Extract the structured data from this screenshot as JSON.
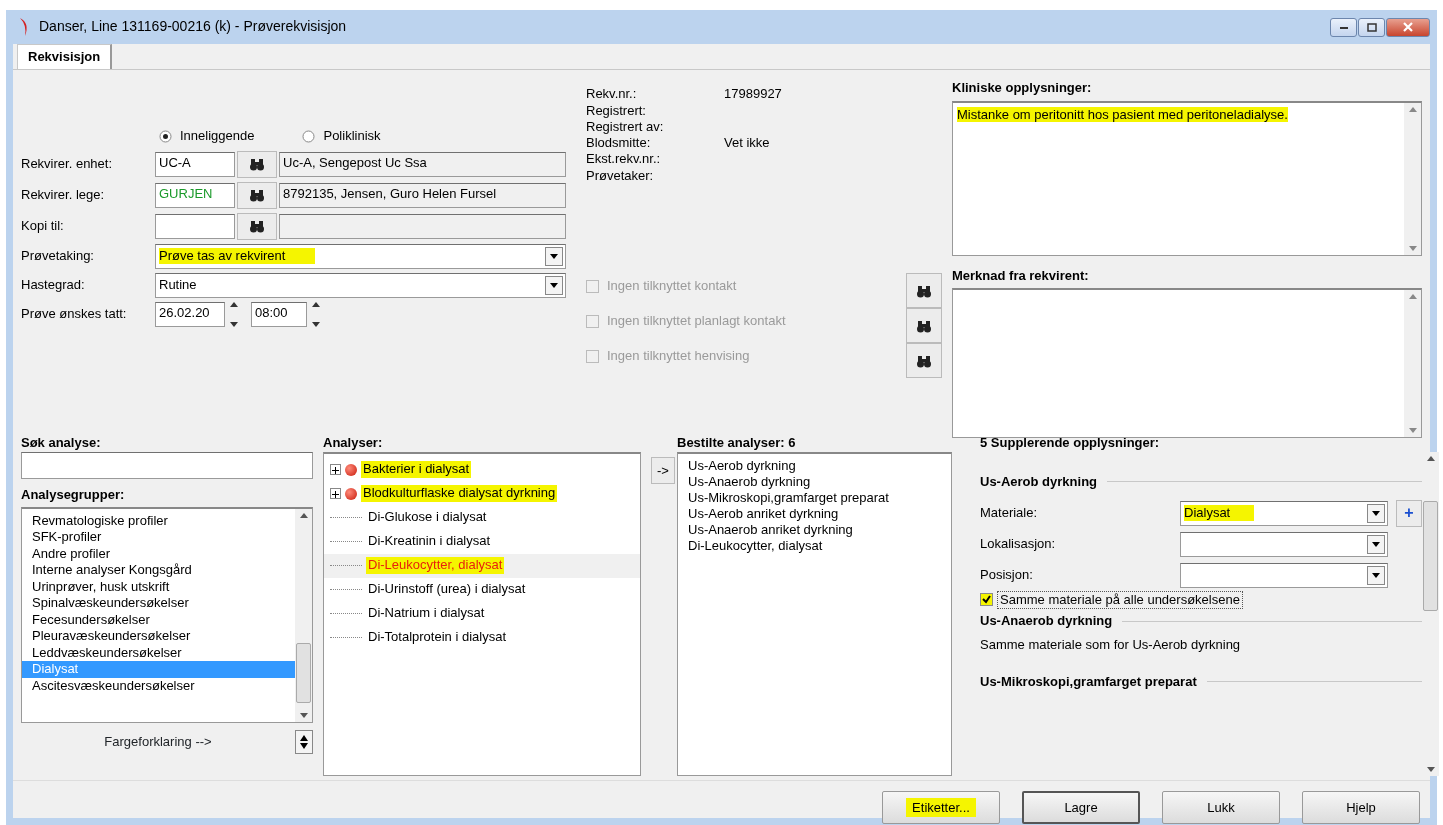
{
  "window": {
    "title": "Danser, Line 131169-00216 (k) - Prøverekvisisjon"
  },
  "tabs": [
    {
      "label": "Rekvisisjon",
      "selected": true
    }
  ],
  "patient_type": [
    {
      "label": "Inneliggende",
      "selected": true
    },
    {
      "label": "Poliklinisk",
      "selected": false
    }
  ],
  "form": [
    {
      "kind": "lookup",
      "label": "Rekvirer. enhet:",
      "code": "UC-A",
      "color": "#000000",
      "description": "Uc-A, Sengepost Uc Ssa"
    },
    {
      "kind": "lookup",
      "label": "Rekvirer. lege:",
      "code": "GURJEN",
      "color": "#1a9a2a",
      "description": "8792135, Jensen, Guro Helen Fursel"
    },
    {
      "kind": "lookup",
      "label": "Kopi til:"
    },
    {
      "kind": "select",
      "label": "Prøvetaking:",
      "value": "Prøve tas av rekvirent",
      "highlighted": true
    },
    {
      "kind": "select",
      "label": "Hastegrad:",
      "value": "Rutine",
      "highlighted": false
    },
    {
      "kind": "datetime",
      "label": "Prøve ønskes tatt:",
      "date": "26.02.20",
      "time": "08:00"
    }
  ],
  "info": [
    {
      "label": "Rekv.nr.:",
      "value": "17989927"
    },
    {
      "label": "Registrert:"
    },
    {
      "label": "Registrert av:"
    },
    {
      "label": "Blodsmitte:",
      "value": "Vet ikke"
    },
    {
      "label": "Ekst.rekv.nr.:"
    },
    {
      "label": "Prøvetaker:"
    }
  ],
  "contact_options": [
    {
      "label": "Ingen tilknyttet kontakt",
      "checked": false,
      "disabled": true
    },
    {
      "label": "Ingen tilknyttet planlagt kontakt",
      "checked": false,
      "disabled": true
    },
    {
      "label": "Ingen tilknyttet henvising",
      "checked": false,
      "disabled": true
    }
  ],
  "clinical_info": {
    "title": "Kliniske opplysninger:",
    "text": "Mistanke om peritonitt hos pasient med peritoneladialyse.",
    "highlighted": true
  },
  "requester_note": {
    "title": "Merknad fra rekvirent:"
  },
  "search": {
    "title": "Søk analyse:"
  },
  "groups": {
    "title": "Analysegrupper:",
    "legend_button": "Fargeforklaring -->",
    "items": [
      {
        "label": "Revmatologiske profiler",
        "selected": false
      },
      {
        "label": "SFK-profiler",
        "selected": false
      },
      {
        "label": "Andre profiler",
        "selected": false
      },
      {
        "label": "Interne analyser Kongsgård",
        "selected": false
      },
      {
        "label": "Urinprøver, husk utskrift",
        "selected": false
      },
      {
        "label": "Spinalvæskeundersøkelser",
        "selected": false
      },
      {
        "label": "Fecesundersøkelser",
        "selected": false
      },
      {
        "label": "Pleuravæskeundersøkelser",
        "selected": false
      },
      {
        "label": "Leddvæskeundersøkelser",
        "selected": false
      },
      {
        "label": "Dialysat",
        "selected": true
      },
      {
        "label": "Ascitesvæskeundersøkelser",
        "selected": false
      }
    ]
  },
  "analyses": {
    "title": "Analyser:",
    "items": [
      {
        "kind": "group",
        "label": "Bakterier i dialysat",
        "ordered": false,
        "highlighted": true,
        "selected": false
      },
      {
        "kind": "group",
        "label": "Blodkulturflaske dialysat dyrkning",
        "ordered": false,
        "highlighted": true,
        "selected": false
      },
      {
        "kind": "leaf",
        "label": "Di-Glukose i dialysat",
        "ordered": false,
        "highlighted": false,
        "selected": false
      },
      {
        "kind": "leaf",
        "label": "Di-Kreatinin i dialysat",
        "ordered": false,
        "highlighted": false,
        "selected": false
      },
      {
        "kind": "leaf",
        "label": "Di-Leukocytter,  dialysat",
        "ordered": true,
        "highlighted": true,
        "selected": true
      },
      {
        "kind": "leaf",
        "label": "Di-Urinstoff (urea) i dialysat",
        "ordered": false,
        "highlighted": false,
        "selected": false
      },
      {
        "kind": "leaf",
        "label": "Di-Natrium i dialysat",
        "ordered": false,
        "highlighted": false,
        "selected": false
      },
      {
        "kind": "leaf",
        "label": "Di-Totalprotein i dialysat",
        "ordered": false,
        "highlighted": false,
        "selected": false
      }
    ]
  },
  "add_button": "->",
  "ordered": {
    "title": "Bestilte analyser: 6",
    "items": [
      "Us-Aerob dyrkning",
      "Us-Anaerob dyrkning",
      "Us-Mikroskopi,gramfarget preparat",
      "Us-Aerob anriket dyrkning",
      "Us-Anaerob anriket dyrkning",
      "Di-Leukocytter,  dialysat"
    ]
  },
  "supplementary": {
    "title": "5 Supplerende opplysninger:",
    "sections": [
      {
        "heading": "Us-Aerob dyrkning",
        "fields": [
          {
            "label": "Materiale:",
            "value": "Dialysat",
            "highlighted": true,
            "add_button": "+"
          },
          {
            "label": "Lokalisasjon:"
          },
          {
            "label": "Posisjon:"
          }
        ],
        "same_material": {
          "label": "Samme materiale på alle undersøkelsene",
          "checked": true,
          "highlighted": true
        }
      },
      {
        "heading": "Us-Anaerob dyrkning",
        "note": "Samme materiale som for Us-Aerob dyrkning"
      },
      {
        "heading": "Us-Mikroskopi,gramfarget preparat"
      }
    ]
  },
  "buttons": [
    {
      "label": "Etiketter...",
      "highlighted": true,
      "default": false
    },
    {
      "label": "Lagre",
      "highlighted": false,
      "default": true
    },
    {
      "label": "Lukk",
      "highlighted": false,
      "default": false
    },
    {
      "label": "Hjelp",
      "highlighted": false,
      "default": false
    }
  ]
}
